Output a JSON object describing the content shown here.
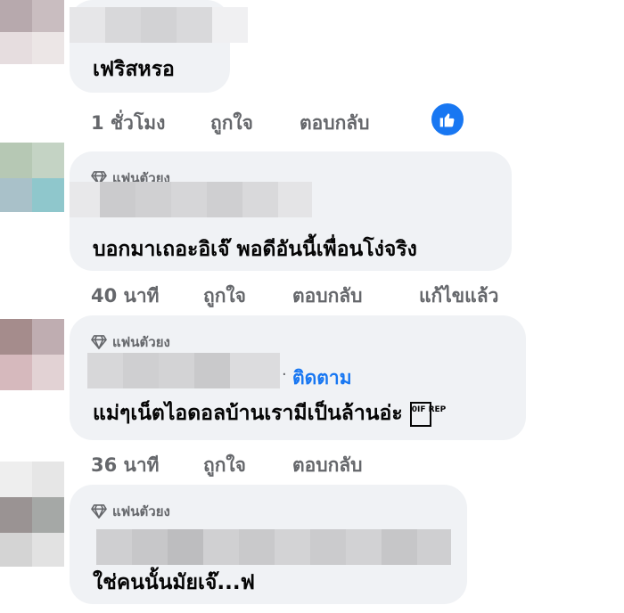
{
  "comments": [
    {
      "text": "เฟริสหรอ",
      "actions": {
        "time": "1 ชั่วโมง",
        "like": "ถูกใจ",
        "reply": "ตอบกลับ"
      },
      "reaction": "like-icon"
    },
    {
      "badge": "แฟนตัวยง",
      "text": "บอกมาเถอะอิเจ๊ พอดีอันนี้เพื่อนโง่จริง",
      "actions": {
        "time": "40 นาที",
        "like": "ถูกใจ",
        "reply": "ตอบกลับ",
        "edited": "แก้ไขแล้ว"
      }
    },
    {
      "badge": "แฟนตัวยง",
      "follow": "ติดตาม",
      "text": "แม่ๆเน็ตไอดอลบ้านเรามีเป็นล้านอ่ะ",
      "emoji": "0IF REP",
      "actions": {
        "time": "36 นาที",
        "like": "ถูกใจ",
        "reply": "ตอบกลับ"
      }
    },
    {
      "badge": "แฟนตัวยง",
      "text": "ใช่คนนั้นมัยเจ๊...ฟ"
    }
  ],
  "colors": {
    "accent": "#1877f2",
    "bubble": "#f0f2f5",
    "meta": "#65676b"
  }
}
